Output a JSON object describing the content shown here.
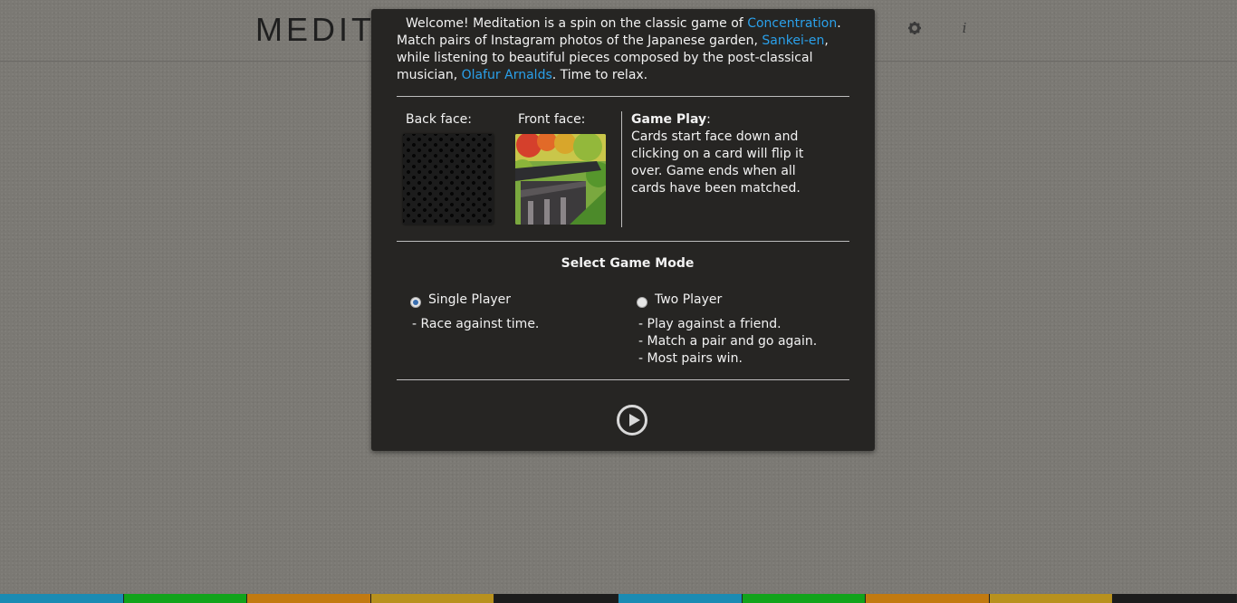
{
  "header": {
    "logo": "MEDITATION",
    "icons": [
      "headphones-icon",
      "gear-icon",
      "info-icon"
    ]
  },
  "modal": {
    "intro": {
      "p1": "Welcome! Meditation is a spin on the classic game of ",
      "link_concentration": "Concentration",
      "p2": ". Match pairs of Instagram photos of the Japanese garden, ",
      "link_sankei": "Sankei-en",
      "p3": ", while listening to beautiful pieces composed by the post-classical musician, ",
      "link_olafur": "Olafur Arnalds",
      "p4": ". Time to relax."
    },
    "back_face_label": "Back face:",
    "front_face_label": "Front face:",
    "gameplay_title": "Game Play",
    "gameplay_colon": ":",
    "gameplay_text": "Cards start face down and clicking on a card will flip it over. Game ends when all cards have been matched.",
    "mode_title": "Select Game Mode",
    "modes": [
      {
        "label": "Single Player",
        "selected": true,
        "desc": [
          "- Race against time."
        ]
      },
      {
        "label": "Two Player",
        "selected": false,
        "desc": [
          "- Play against a friend.",
          "- Match a pair and go again.",
          "- Most pairs win."
        ]
      }
    ]
  },
  "colors": {
    "link": "#2aa0ea",
    "stripes": [
      "#1b8bb3",
      "#11a31b",
      "#c27a10",
      "#b8911e",
      "#1c1c1c",
      "#1b8bb3",
      "#11a31b",
      "#c27a10",
      "#b8911e",
      "#1c1c1c"
    ]
  }
}
